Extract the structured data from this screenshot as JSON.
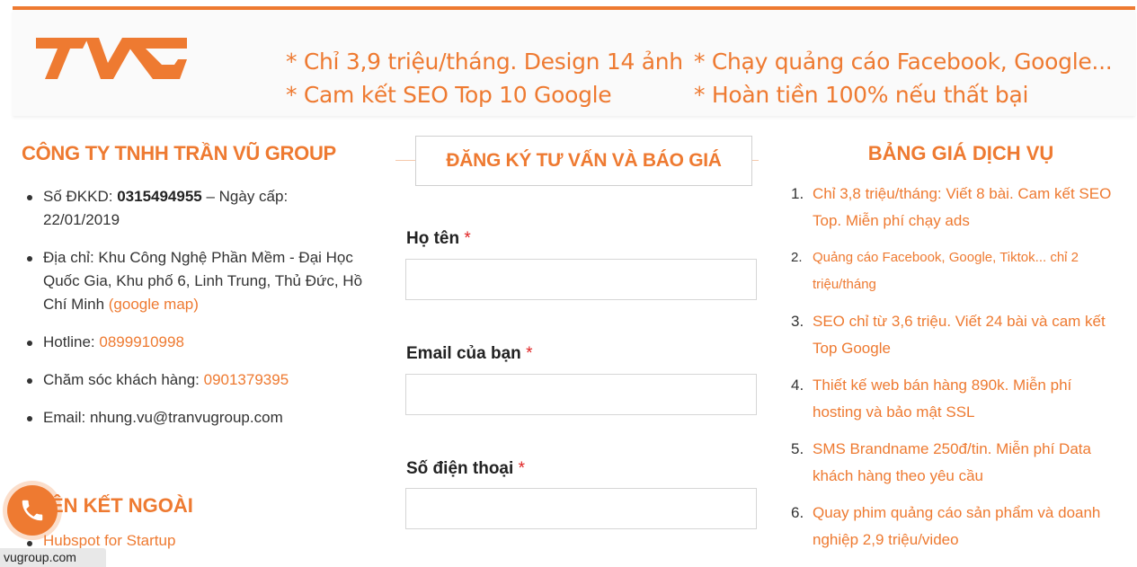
{
  "header": {
    "promos": [
      "* Chỉ 3,9 triệu/tháng. Design 14 ảnh",
      "* Chạy quảng cáo Facebook, Google...",
      "* Cam kết SEO Top 10 Google",
      "* Hoàn tiền 100% nếu thất bại"
    ],
    "logo_text": "TVG",
    "accent": "#ee7a31"
  },
  "company": {
    "title": "CÔNG TY TNHH TRẦN VŨ GROUP",
    "reg_prefix": "Số ĐKKD: ",
    "reg_number": "0315494955",
    "reg_suffix": " – Ngày cấp: 22/01/2019",
    "address_text": "Địa chỉ: Khu Công Nghệ Phần Mềm - Đại Học Quốc Gia, Khu phố 6, Linh Trung, Thủ Đức, Hồ Chí Minh ",
    "address_link": "(google map)",
    "hotline_label": "Hotline: ",
    "hotline": "0899910998",
    "care_label": "Chăm sóc khách hàng: ",
    "care_phone": "0901379395",
    "email_text": "Email: nhung.vu@tranvugroup.com"
  },
  "links_section": {
    "title": "ÊN KẾT NGOÀI",
    "item": "Hubspot for Startup"
  },
  "status_url": "vugroup.com",
  "form": {
    "title": "ĐĂNG KÝ TƯ VẤN VÀ BÁO GIÁ",
    "fields": [
      {
        "label": "Họ tên",
        "req": "*",
        "value": ""
      },
      {
        "label": "Email của bạn",
        "req": "*",
        "value": ""
      },
      {
        "label": "Số điện thoại",
        "req": "*",
        "value": ""
      }
    ]
  },
  "pricing": {
    "title": "BẢNG GIÁ DỊCH VỤ",
    "items": [
      {
        "num": "1.",
        "line1": "Chỉ 3,8 triệu/tháng: Viết 8 bài. Cam kết SEO",
        "line2": "Top. Miễn phí chạy ads"
      },
      {
        "num": "2.",
        "line1": "Quảng cáo Facebook, Google, Tiktok... chỉ 2",
        "line2": "triệu/tháng"
      },
      {
        "num": "3.",
        "line1": "SEO chỉ từ 3,6 triệu. Viết 24 bài và cam kết",
        "line2": "Top Google"
      },
      {
        "num": "4.",
        "line1": "Thiết kế web bán hàng 890k. Miễn phí",
        "line2": "hosting và bảo mật SSL"
      },
      {
        "num": "5.",
        "line1": "SMS Brandname 250đ/tin. Miễn phí Data",
        "line2": "khách hàng theo yêu cầu"
      },
      {
        "num": "6.",
        "line1": "Quay phim quảng cáo sản phẩm và doanh",
        "line2": "nghiệp 2,9 triệu/video"
      }
    ]
  }
}
